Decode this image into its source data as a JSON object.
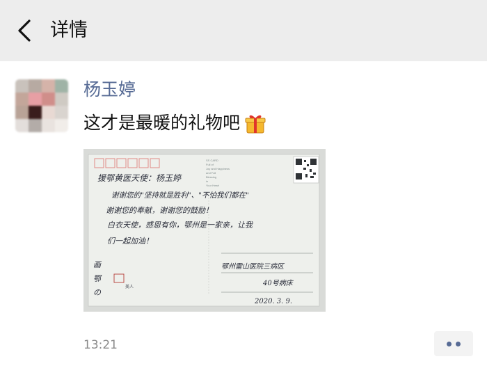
{
  "header": {
    "back_icon": "chevron-left-icon",
    "title": "详情"
  },
  "post": {
    "author": "杨玉婷",
    "text": "这才是最暖的礼物吧",
    "emoji": "gift-icon",
    "time": "13:21",
    "more_icon": "more-dots-icon",
    "name_color": "#576b95"
  },
  "postcard": {
    "header_lines": [
      "SS CARD",
      "Full of",
      "Joy and Happiness",
      "and Full",
      "Blessing",
      "in",
      "Your Heart"
    ],
    "greeting": "援鄂黄医天使：杨玉婷",
    "message_lines": [
      "谢谢您的\"坚持就是胜利\"、\"不怕我们都在\"",
      "谢谢您的奉献，谢谢您的鼓励！",
      "白衣天使，感恩有你，鄂州是一家亲，让我",
      "们一起加油！"
    ],
    "sender_lines": [
      "鄂州雷山医院三病区",
      "40号病床"
    ],
    "date": "2020. 3. 9.",
    "left_caption_lines": [
      "画",
      "鄂",
      "の"
    ],
    "stamp_text": "美人"
  }
}
